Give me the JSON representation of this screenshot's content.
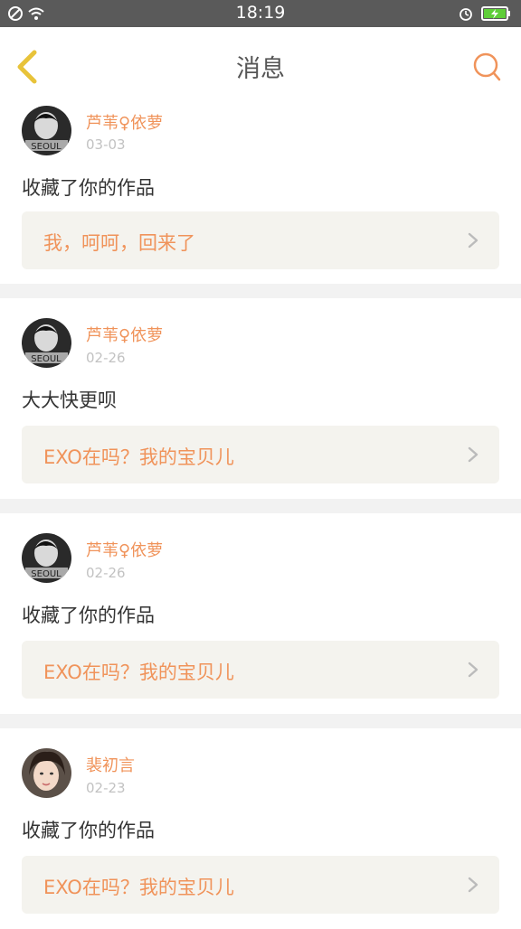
{
  "status_bar": {
    "time": "18:19",
    "left_icons": [
      "block-icon",
      "wifi-icon"
    ],
    "right_icons": [
      "alarm-icon",
      "battery-charging-icon"
    ]
  },
  "header": {
    "title": "消息",
    "back_icon": "chevron-left-icon",
    "search_icon": "search-icon"
  },
  "messages": [
    {
      "user": "芦苇♀依萝",
      "date": "03-03",
      "action": "收藏了你的作品",
      "work_title": "我，呵呵，回来了",
      "avatar": "dark-avatar"
    },
    {
      "user": "芦苇♀依萝",
      "date": "02-26",
      "action": "大大快更呗",
      "work_title": "EXO在吗？我的宝贝儿",
      "avatar": "dark-avatar"
    },
    {
      "user": "芦苇♀依萝",
      "date": "02-26",
      "action": "收藏了你的作品",
      "work_title": "EXO在吗？我的宝贝儿",
      "avatar": "dark-avatar"
    },
    {
      "user": "裴初言",
      "date": "02-23",
      "action": "收藏了你的作品",
      "work_title": "EXO在吗？我的宝贝儿",
      "avatar": "portrait-avatar"
    }
  ],
  "colors": {
    "accent": "#f0935a",
    "nav_back": "#e8c33a",
    "status_bar": "#5a5a5a",
    "card_box": "#f4f3ee",
    "divider": "#f2f2f2"
  }
}
